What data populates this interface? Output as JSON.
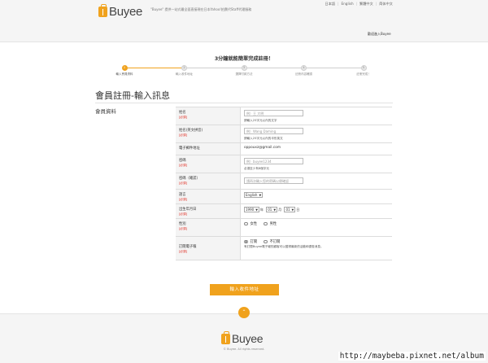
{
  "header": {
    "logo_text": "Buyee",
    "tagline": "\"Buyee\" 提供一站式最全面直接現在日本Yahoo!拍賣代Staff代理服務",
    "languages": [
      "日本語",
      "English",
      "繁體中文",
      "简体中文"
    ],
    "already_member": "歡迎進入Buyee"
  },
  "progress": {
    "title": "3分鐘就能簡單完成註冊！",
    "steps": [
      {
        "num": "1",
        "label": "輸入會員資料",
        "active": true
      },
      {
        "num": "2",
        "label": "輸入收件地址",
        "active": false
      },
      {
        "num": "3",
        "label": "選擇付款方法",
        "active": false
      },
      {
        "num": "4",
        "label": "註冊內容確認",
        "active": false
      },
      {
        "num": "5",
        "label": "註冊完成！",
        "active": false
      }
    ]
  },
  "page": {
    "title": "會員註冊-輸入訊息",
    "section_label": "會員資料"
  },
  "form": {
    "required": "[必須]",
    "name_label": "姓名",
    "name_placeholder": "例）王 大明",
    "name_hint": "請輸入25字元以內的文字",
    "name_en_label": "姓名(英文拼音)",
    "name_en_placeholder": "例）Wang Daming",
    "name_en_hint": "請輸入25字元以內的半形英文",
    "email_label": "電子郵件地址",
    "email_value": "oppouxz@gmail.com",
    "password_label": "密碼",
    "password_placeholder": "例）buyee1234",
    "password_hint": "必須至少有8個字元",
    "password_confirm_label": "密碼（確認）",
    "password_confirm_placeholder": "請再次輸入您的密碼以便確認",
    "language_label": "語言",
    "language_value": "English",
    "birthday_label": "出生年月日",
    "birthday_year": "1990",
    "birthday_year_unit": "年",
    "birthday_month": "01",
    "birthday_month_unit": "月",
    "birthday_day": "01",
    "birthday_day_unit": "日",
    "gender_label": "性別",
    "gender_options": [
      "女性",
      "男性"
    ],
    "newsletter_label": "訂閱電子報",
    "newsletter_options": [
      "訂閱",
      "不訂閱"
    ],
    "newsletter_hint": "有訂閱Buyee電子報的顧客可以獲得最新的活動和優惠消息。"
  },
  "submit_label": "輸入收件地址",
  "footer": {
    "logo_text": "Buyee",
    "copyright": "© Buyee. All rights reserved.",
    "watermark": "http://maybeba.pixnet.net/album"
  },
  "colors": {
    "accent": "#f0a21d",
    "required": "#e0261b"
  }
}
